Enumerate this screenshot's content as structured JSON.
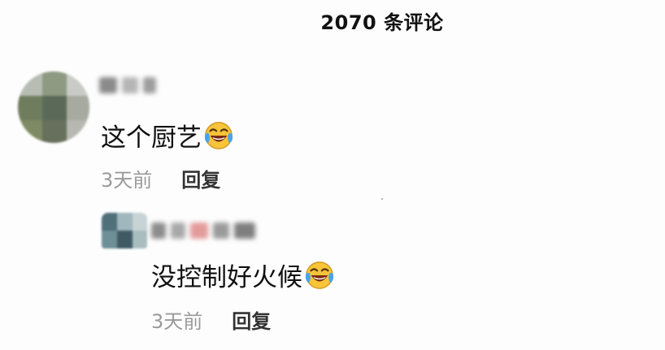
{
  "header": {
    "title": "2070 条评论"
  },
  "comments": [
    {
      "text": "这个厨艺",
      "emoji": "laughing-tears-emoji",
      "time": "3天前",
      "reply_label": "回复"
    },
    {
      "text": "没控制好火候",
      "emoji": "laughing-tears-emoji",
      "time": "3天前",
      "reply_label": "回复"
    }
  ],
  "colors": {
    "text": "#111111",
    "muted": "#9a9a9a",
    "reply": "#333333",
    "emoji_face": "#f7c43a",
    "emoji_tear": "#4aa3e8"
  }
}
